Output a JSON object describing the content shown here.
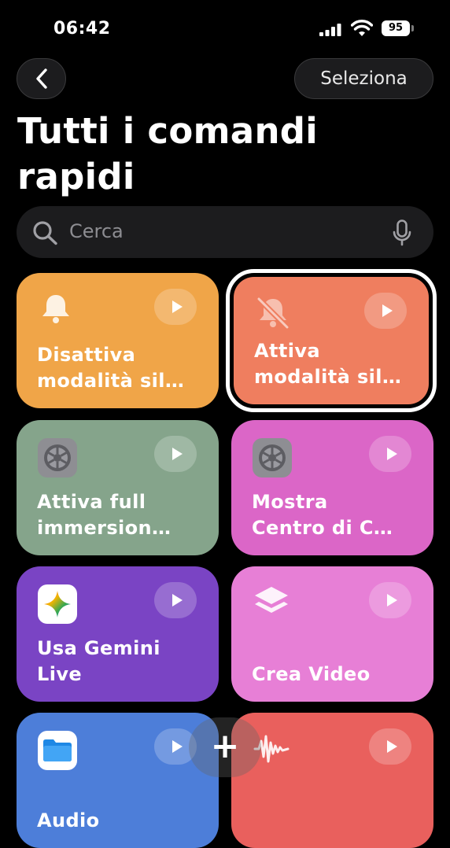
{
  "status": {
    "time": "06:42",
    "battery": "95"
  },
  "nav": {
    "back_icon": "chevron-left-icon",
    "select_label": "Seleziona"
  },
  "page_title": "Tutti i comandi\nrapidi",
  "search": {
    "placeholder": "Cerca"
  },
  "shortcuts": [
    {
      "title": "Disattiva\nmodalità sil…",
      "icon": "bell-icon",
      "color": "#f0a548"
    },
    {
      "title": "Attiva\nmodalità sil…",
      "icon": "bell-slash-icon",
      "color": "#ef7e5f",
      "selected": true
    },
    {
      "title": "Attiva full\nimmersion…",
      "icon": "settings-gear-icon",
      "color": "#85a48b"
    },
    {
      "title": "Mostra\nCentro di C…",
      "icon": "settings-gear-icon",
      "color": "#db66c7"
    },
    {
      "title": "Usa Gemini\nLive",
      "icon": "gemini-app-icon",
      "color": "#7a44c4"
    },
    {
      "title": "Crea Video",
      "icon": "layers-icon",
      "color": "#e77fd6"
    },
    {
      "title": "Audio",
      "icon": "files-app-icon",
      "color": "#4d7ed9"
    },
    {
      "title": "",
      "icon": "waveform-icon",
      "color": "#e9605d"
    }
  ],
  "add_button": {
    "label": "+"
  }
}
